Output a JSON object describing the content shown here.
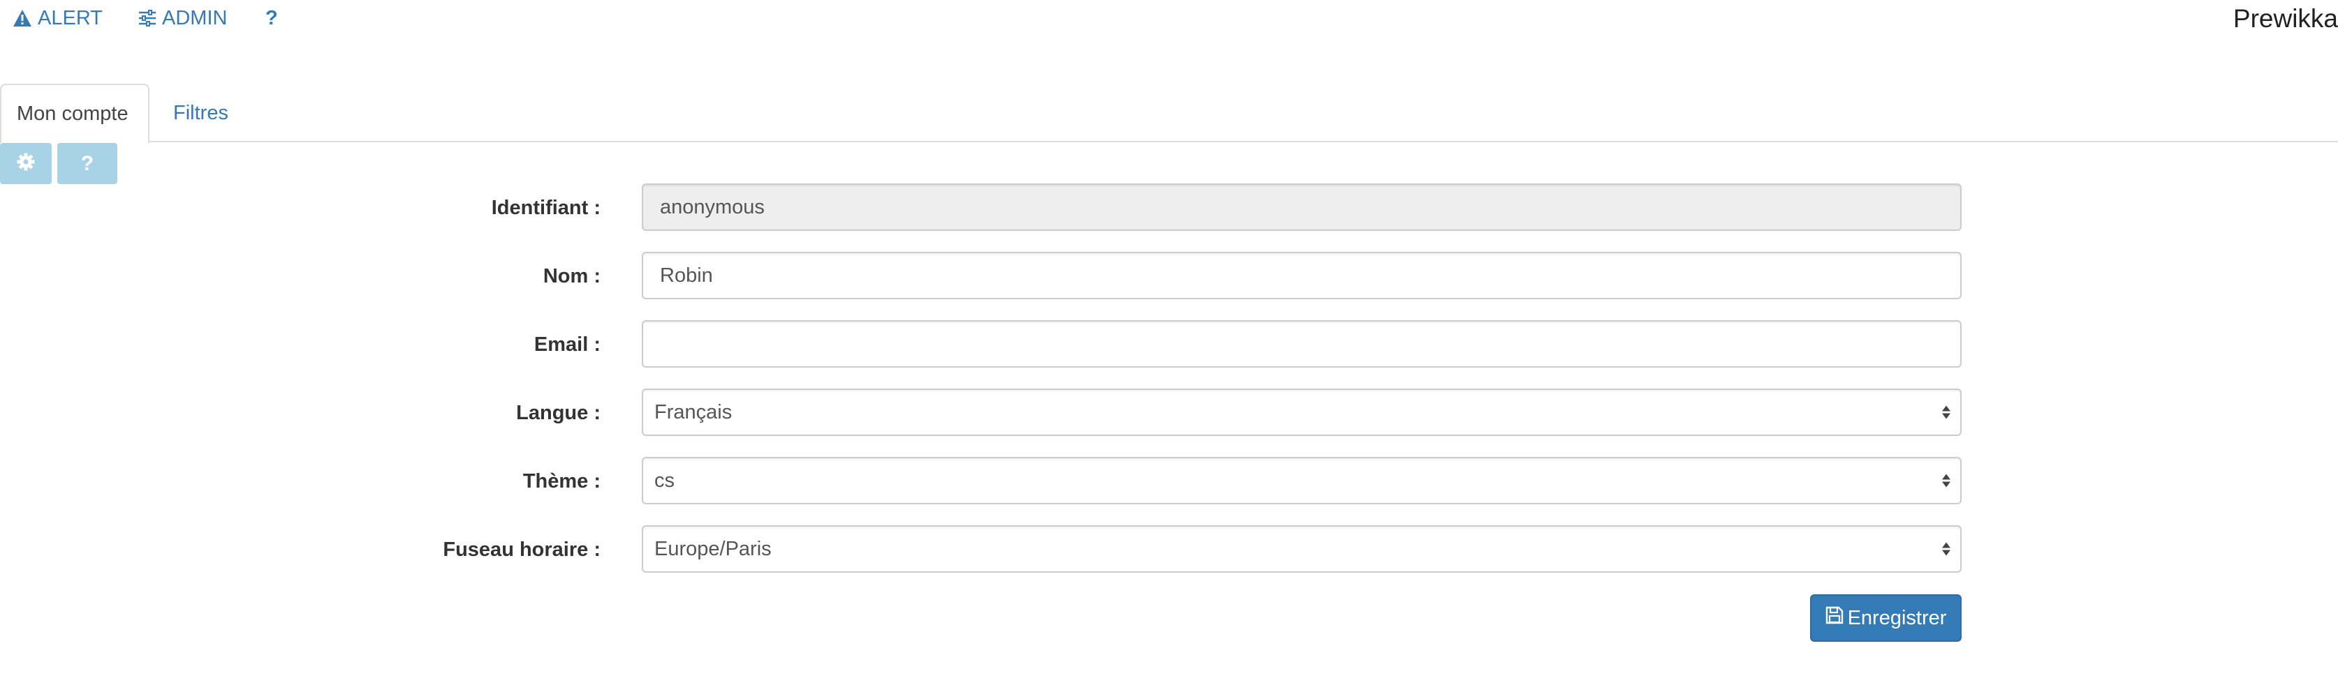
{
  "topnav": {
    "alert_label": "ALERT",
    "admin_label": "ADMIN",
    "help_label": "?",
    "brand": "Prewikka"
  },
  "tabs": [
    {
      "label": "Mon compte",
      "active": true
    },
    {
      "label": "Filtres",
      "active": false
    }
  ],
  "toolbar": {
    "gear_icon": "gear-icon",
    "help_label": "?"
  },
  "form": {
    "login": {
      "label": "Identifiant :",
      "value": "anonymous"
    },
    "name": {
      "label": "Nom :",
      "value": "Robin"
    },
    "email": {
      "label": "Email :",
      "value": ""
    },
    "language": {
      "label": "Langue :",
      "value": "Français"
    },
    "theme": {
      "label": "Thème :",
      "value": "cs"
    },
    "timezone": {
      "label": "Fuseau horaire :",
      "value": "Europe/Paris"
    },
    "save_label": "Enregistrer"
  },
  "colors": {
    "link": "#337ab7",
    "primary_button": "#337ab7",
    "toolbar_button": "#a8d3e6",
    "readonly_bg": "#eeeeee"
  }
}
